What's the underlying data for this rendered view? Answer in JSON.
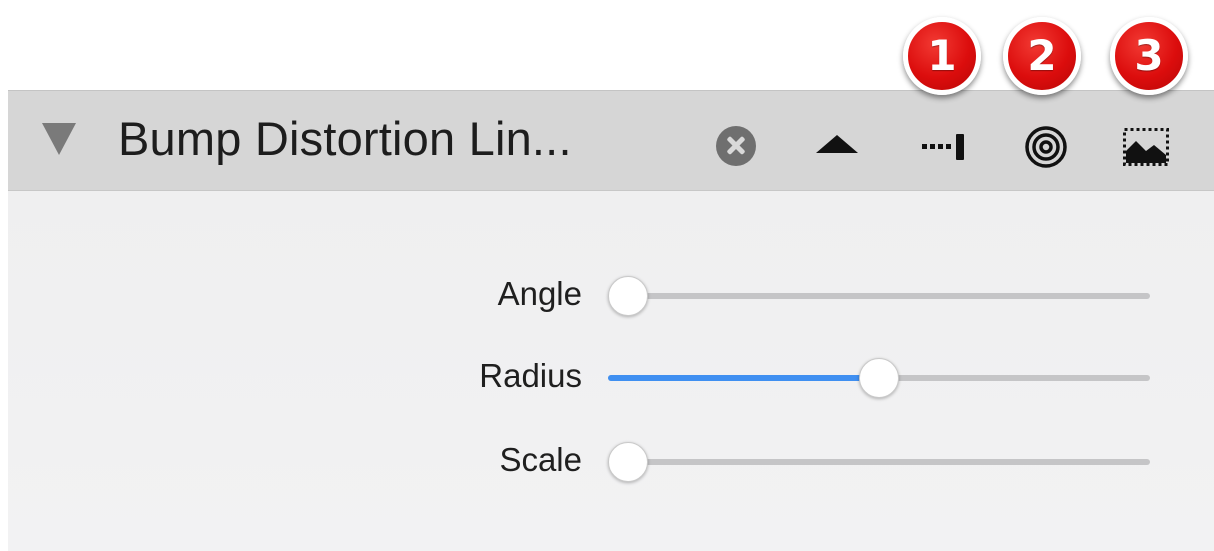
{
  "callouts": [
    "1",
    "2",
    "3"
  ],
  "header": {
    "title": "Bump Distortion Lin...",
    "icons": {
      "disclosure": "disclosure-triangle-down-icon",
      "close": "close-circle-icon",
      "collapse": "collapse-up-icon",
      "parameter": "parameter-slider-icon",
      "target": "concentric-target-icon",
      "image": "image-mask-icon"
    }
  },
  "sliders": [
    {
      "label": "Angle",
      "value": 0.0
    },
    {
      "label": "Radius",
      "value": 0.5
    },
    {
      "label": "Scale",
      "value": 0.0
    }
  ],
  "colors": {
    "accent": "#3f8ff1",
    "callout": "#dc0d0d",
    "header_bg": "#d6d6d6",
    "panel_bg": "#f0f0f1"
  }
}
